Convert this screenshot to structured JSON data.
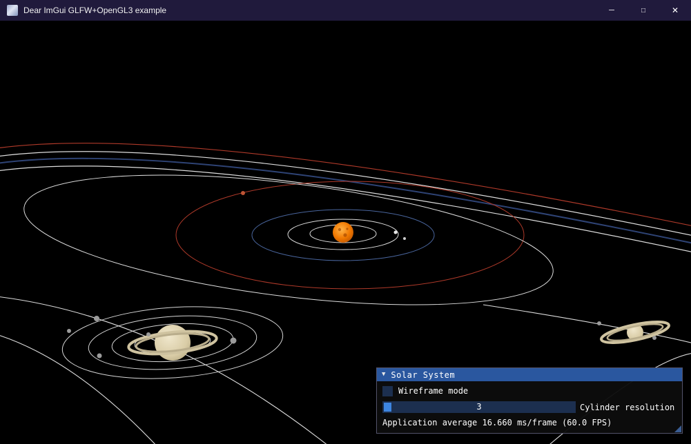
{
  "window": {
    "title": "Dear ImGui GLFW+OpenGL3 example",
    "controls": {
      "minimize": "─",
      "maximize": "□",
      "close": "✕"
    }
  },
  "panel": {
    "collapse_glyph": "▼",
    "title": "Solar System",
    "wireframe_label": "Wireframe mode",
    "wireframe_checked": false,
    "slider_value": "3",
    "slider_label": "Cylinder resolution",
    "stats": "Application average 16.660 ms/frame (60.0 FPS)"
  },
  "scene": {
    "colors": {
      "background": "#000000",
      "orbit_white": "#dedede",
      "orbit_red": "#b03a2a",
      "orbit_navy": "#2e4375",
      "orbit_blue": "#4a669e",
      "sun_center": "#ffb347",
      "sun_mid": "#f07800",
      "sun_edge": "#b44e00",
      "planet_tan_light": "#efe6cb",
      "planet_tan": "#d9cca6",
      "planet_tan_dark": "#b3a67f",
      "ring_outer": "#cfc3a0",
      "ring_inner": "#b9ad8c",
      "moon_gray": "#9b9b9b",
      "mars_dot": "#c05535"
    }
  },
  "ui_colors": {
    "titlebar_bg": "#201a3c",
    "imgui_title_bg": "#2a579f",
    "imgui_frame_bg": "#1c2f4f",
    "imgui_slider_grab": "#3d85e0",
    "imgui_border": "#53536b",
    "text": "#ffffff"
  }
}
